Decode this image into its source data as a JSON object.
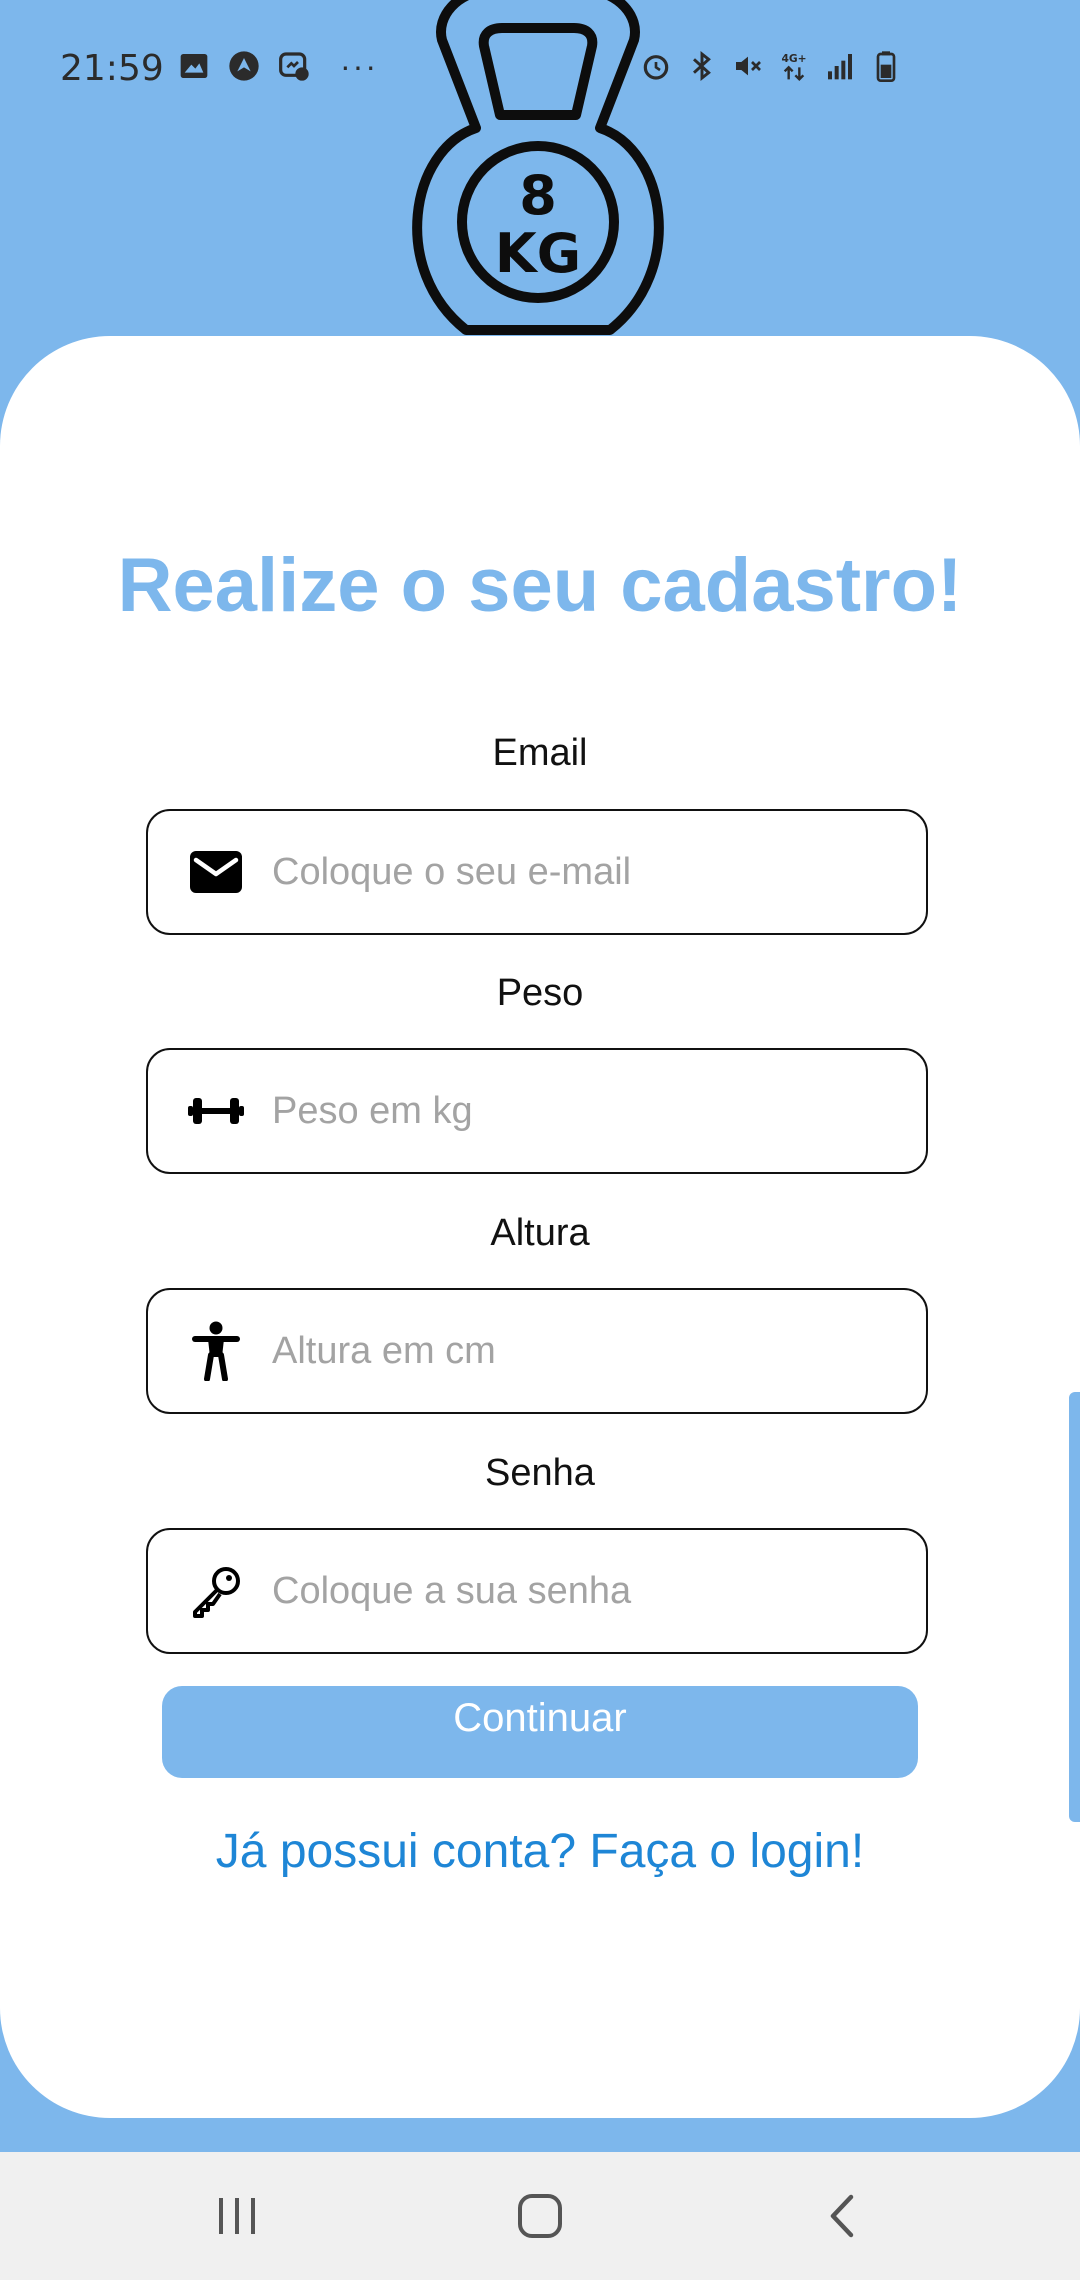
{
  "status_bar": {
    "time": "21:59",
    "left_icons": [
      "image-icon",
      "nav-app-icon",
      "messenger-icon",
      "more-dots-icon"
    ],
    "right_icons": [
      "alarm-icon",
      "bluetooth-icon",
      "mute-icon",
      "4g-data-icon",
      "signal-icon",
      "battery-icon"
    ],
    "more": "···",
    "network_label": "4G+"
  },
  "logo": {
    "icon": "kettlebell-icon",
    "weight_number": "8",
    "weight_unit": "KG"
  },
  "form": {
    "title": "Realize o seu cadastro!",
    "fields": [
      {
        "label": "Email",
        "placeholder": "Coloque o seu e-mail",
        "value": "",
        "icon": "envelope-icon"
      },
      {
        "label": "Peso",
        "placeholder": "Peso em kg",
        "value": "",
        "icon": "dumbbell-icon"
      },
      {
        "label": "Altura",
        "placeholder": "Altura em cm",
        "value": "",
        "icon": "person-icon"
      },
      {
        "label": "Senha",
        "placeholder": "Coloque a sua senha",
        "value": "",
        "icon": "key-icon"
      }
    ],
    "continue_label": "Continuar",
    "login_link": "Já possui conta? Faça o login!"
  },
  "nav_bar": {
    "buttons": [
      "recents-icon",
      "home-icon",
      "back-icon"
    ]
  },
  "colors": {
    "background": "#7db7ec",
    "accent": "#7db7ec",
    "link": "#1e86d6",
    "card": "#ffffff",
    "nav_bar": "#f0f0f0"
  }
}
